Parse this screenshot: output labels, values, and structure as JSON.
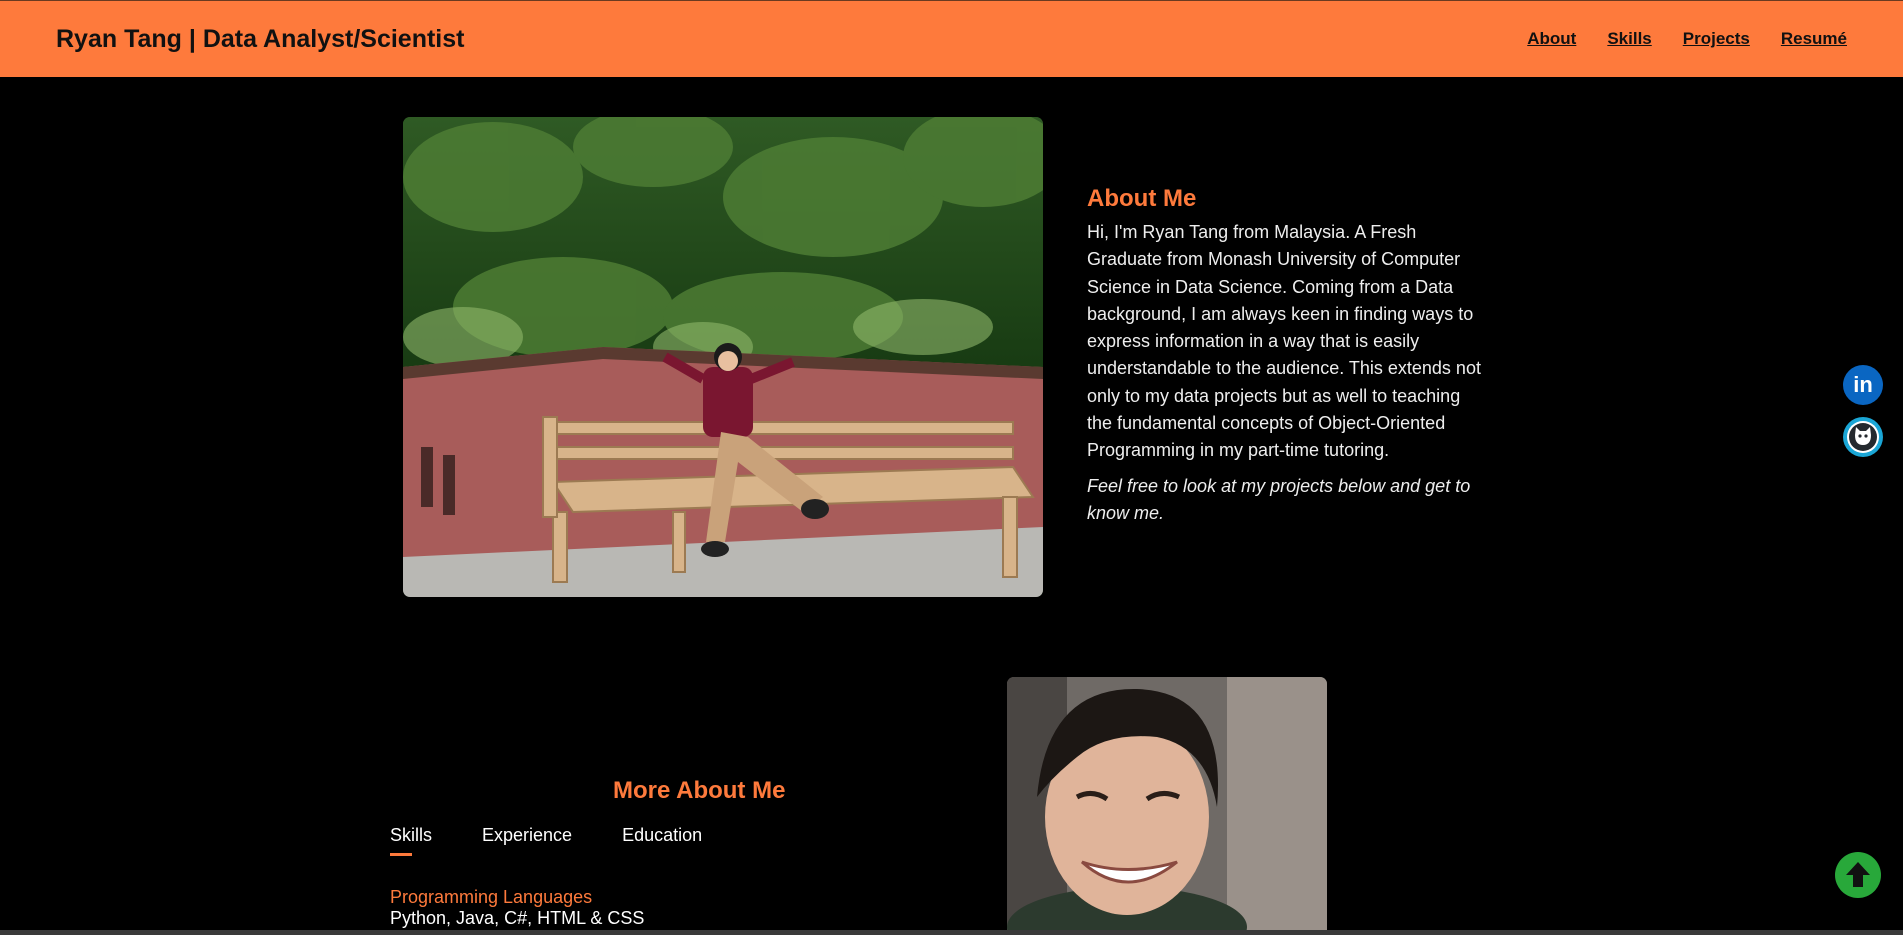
{
  "header": {
    "title": "Ryan Tang | Data Analyst/Scientist",
    "nav": [
      "About",
      "Skills",
      "Projects",
      "Resumé"
    ]
  },
  "about": {
    "heading": "About Me",
    "body": "Hi, I'm Ryan Tang from Malaysia. A Fresh Graduate from Monash University of Computer Science in Data Science. Coming from a Data background, I am always keen in finding ways to express information in a way that is easily understandable to the audience. This extends not only to my data projects but as well to teaching the fundamental concepts of Object-Oriented Programming in my part-time tutoring.",
    "cta": "Feel free to look at my projects below and get to know me."
  },
  "more": {
    "heading": "More About Me",
    "tabs": [
      "Skills",
      "Experience",
      "Education"
    ],
    "active_tab": "Skills",
    "skills": {
      "title": "Programming Languages",
      "value": "Python, Java, C#, HTML & CSS"
    }
  },
  "social": {
    "linkedin_label": "in"
  },
  "colors": {
    "accent": "#fe7a3c",
    "background": "#000000",
    "scroll_top": "#28a83a"
  },
  "icons": [
    "linkedin-icon",
    "github-icon",
    "arrow-up-icon"
  ]
}
